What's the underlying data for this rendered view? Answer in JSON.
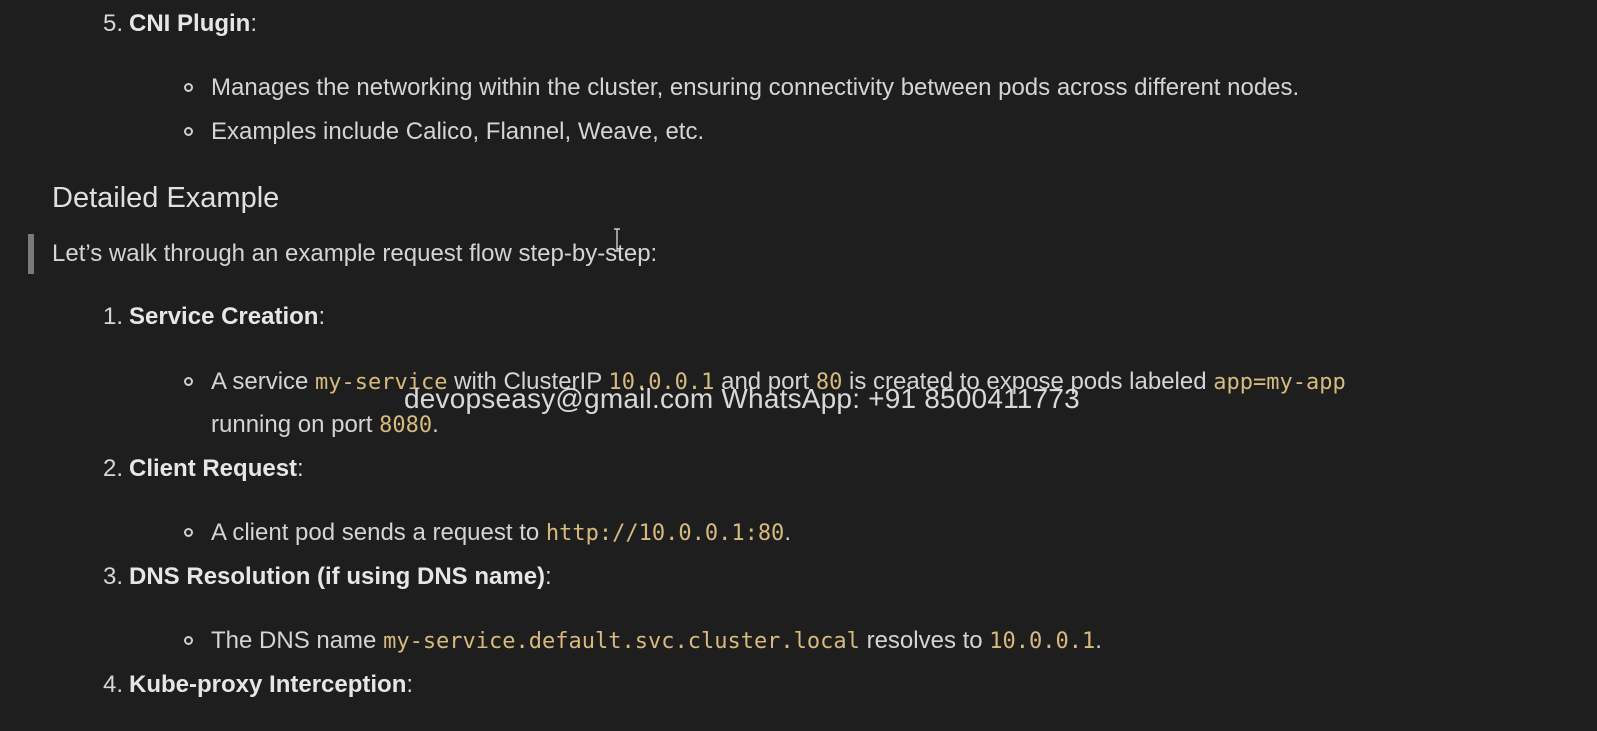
{
  "item5": {
    "number": "5.",
    "title": "CNI Plugin",
    "suffix": ":",
    "bullets": [
      "Manages the networking within the cluster, ensuring connectivity between pods across different nodes.",
      "Examples include Calico, Flannel, Weave, etc."
    ]
  },
  "section": {
    "heading": "Detailed Example",
    "quote": "Let’s walk through an example request flow step-by-step:"
  },
  "steps": {
    "s1": {
      "number": "1.",
      "title": "Service Creation",
      "suffix": ":",
      "b1_t1": "A service ",
      "b1_c1": "my-service",
      "b1_t2": " with ClusterIP ",
      "b1_c2": "10.0.0.1",
      "b1_t3": " and port ",
      "b1_c3": "80",
      "b1_t4": " is created to expose pods labeled ",
      "b1_c4": "app=my-app",
      "b1_t5": "running on port ",
      "b1_c5": "8080",
      "b1_t6": "."
    },
    "s2": {
      "number": "2.",
      "title": "Client Request",
      "suffix": ":",
      "b1_t1": "A client pod sends a request to ",
      "b1_c1": "http://10.0.0.1:80",
      "b1_t2": "."
    },
    "s3": {
      "number": "3.",
      "title": "DNS Resolution (if using DNS name)",
      "suffix": ":",
      "b1_t1": "The DNS name ",
      "b1_c1": "my-service.default.svc.cluster.local",
      "b1_t2": " resolves to ",
      "b1_c2": "10.0.0.1",
      "b1_t3": "."
    },
    "s4": {
      "number": "4.",
      "title": "Kube-proxy Interception",
      "suffix": ":"
    }
  },
  "watermark": "devopseasy@gmail.com WhatsApp: +91 8500411773",
  "colors": {
    "background": "#1e1e1e",
    "text": "#d4d4d4",
    "code": "#d7ba7d",
    "quote_bar": "#7a7a7a"
  }
}
